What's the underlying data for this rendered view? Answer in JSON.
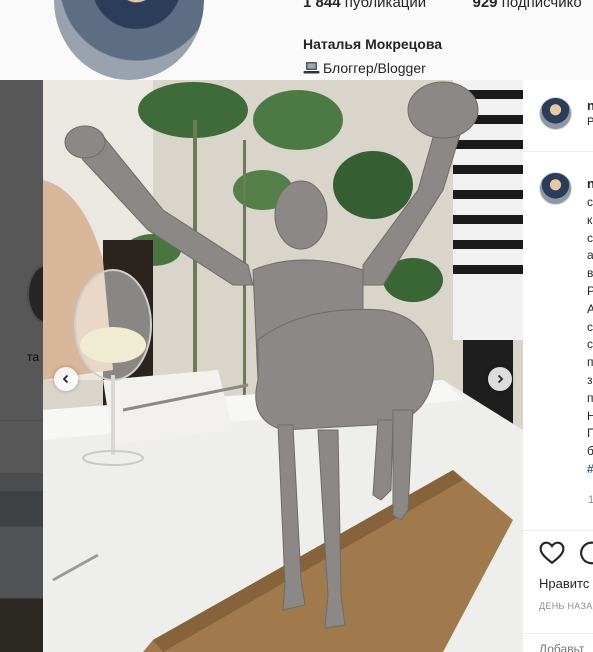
{
  "profile": {
    "posts_count": "1 844",
    "posts_label": "публикации",
    "followers_count": "929",
    "followers_label": "подписчико",
    "name": "Наталья Мокрецова",
    "bio": "Блоггер/Blogger",
    "highlight_label": "та"
  },
  "post": {
    "header_user": "n",
    "header_sub": "P",
    "caption_user": "n",
    "caption_lines": [
      "c",
      "к",
      "c",
      "a",
      "в",
      "P",
      "A",
      "c",
      "c",
      "п",
      "з",
      "п",
      "H",
      "П",
      "б"
    ],
    "caption_hashtag": "#",
    "time_fragment": "1",
    "likes_text": "Нравитс",
    "date_text": "ДЕНЬ НАЗАД",
    "comment_placeholder": "Добавьт"
  },
  "icons": {
    "bio": "laptop-icon",
    "prev": "chevron-left-icon",
    "next": "chevron-right-icon",
    "like": "heart-icon",
    "comment": "comment-icon"
  }
}
